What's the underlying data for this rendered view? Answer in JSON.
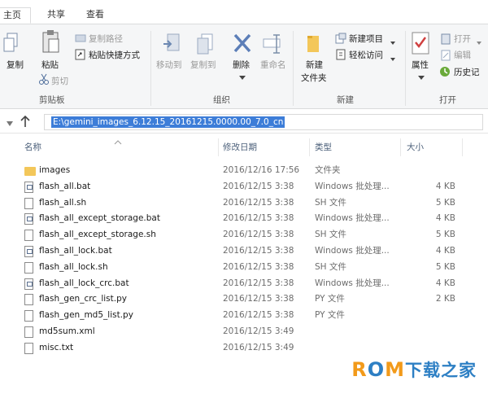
{
  "tabs": [
    "主页",
    "共享",
    "查看"
  ],
  "ribbon": {
    "clipboard": {
      "copy": "复制",
      "paste": "粘贴",
      "copy_path": "复制路径",
      "paste_shortcut": "粘贴快捷方式",
      "cut": "剪切",
      "label": "剪贴板"
    },
    "organize": {
      "move_to": "移动到",
      "copy_to": "复制到",
      "delete": "删除",
      "rename": "重命名",
      "label": "组织"
    },
    "new": {
      "new_item": "新建项目",
      "easy_access": "轻松访问",
      "new_folder_line1": "新建",
      "new_folder_line2": "文件夹",
      "label": "新建"
    },
    "open": {
      "properties": "属性",
      "open": "打开",
      "edit": "编辑",
      "history": "历史记",
      "label": "打开"
    }
  },
  "address": {
    "path": "E:\\gemini_images_6.12.15_20161215.0000.00_7.0_cn"
  },
  "columns": {
    "name": "名称",
    "date": "修改日期",
    "type": "类型",
    "size": "大小"
  },
  "files": [
    {
      "name": "images",
      "date": "2016/12/16 17:56",
      "type": "文件夹",
      "size": "",
      "icon": "folder"
    },
    {
      "name": "flash_all.bat",
      "date": "2016/12/15 3:38",
      "type": "Windows 批处理...",
      "size": "4 KB",
      "icon": "bat"
    },
    {
      "name": "flash_all.sh",
      "date": "2016/12/15 3:38",
      "type": "SH 文件",
      "size": "5 KB",
      "icon": "file"
    },
    {
      "name": "flash_all_except_storage.bat",
      "date": "2016/12/15 3:38",
      "type": "Windows 批处理...",
      "size": "4 KB",
      "icon": "bat"
    },
    {
      "name": "flash_all_except_storage.sh",
      "date": "2016/12/15 3:38",
      "type": "SH 文件",
      "size": "5 KB",
      "icon": "file"
    },
    {
      "name": "flash_all_lock.bat",
      "date": "2016/12/15 3:38",
      "type": "Windows 批处理...",
      "size": "4 KB",
      "icon": "bat"
    },
    {
      "name": "flash_all_lock.sh",
      "date": "2016/12/15 3:38",
      "type": "SH 文件",
      "size": "5 KB",
      "icon": "file"
    },
    {
      "name": "flash_all_lock_crc.bat",
      "date": "2016/12/15 3:38",
      "type": "Windows 批处理...",
      "size": "4 KB",
      "icon": "bat"
    },
    {
      "name": "flash_gen_crc_list.py",
      "date": "2016/12/15 3:38",
      "type": "PY 文件",
      "size": "2 KB",
      "icon": "file"
    },
    {
      "name": "flash_gen_md5_list.py",
      "date": "2016/12/15 3:38",
      "type": "PY 文件",
      "size": "",
      "icon": "file"
    },
    {
      "name": "md5sum.xml",
      "date": "2016/12/15 3:49",
      "type": "",
      "size": "",
      "icon": "file"
    },
    {
      "name": "misc.txt",
      "date": "2016/12/15 3:49",
      "type": "",
      "size": "",
      "icon": "file"
    }
  ],
  "watermark": {
    "r": "R",
    "o": "O",
    "m": "M",
    "rest": "下载之家"
  },
  "colors": {
    "accent": "#3d7dd8",
    "folder": "#f3c75a",
    "watermark_orange": "#f29a1a",
    "watermark_blue": "#2d7fc4"
  }
}
